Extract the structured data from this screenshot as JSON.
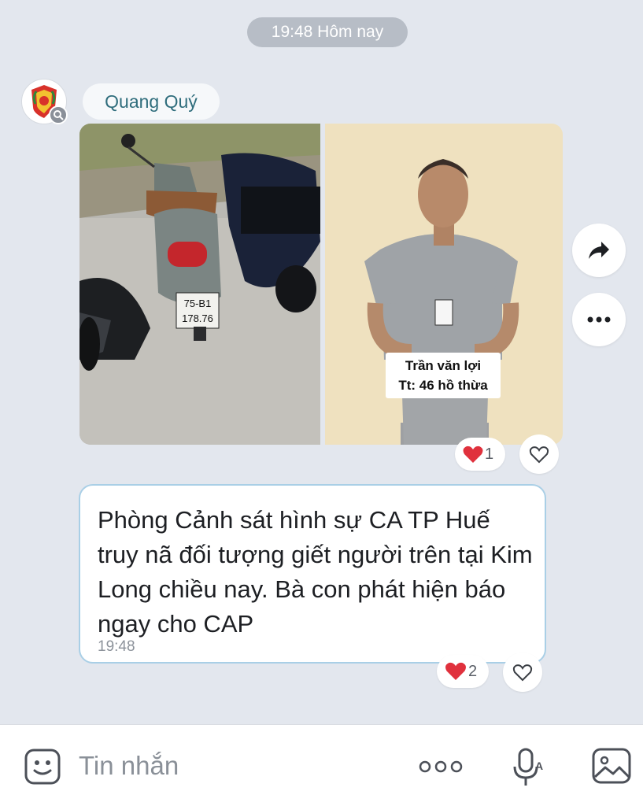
{
  "date_separator": "19:48 Hôm nay",
  "sender": {
    "name": "Quang Quý",
    "avatar_icon": "police-emblem-icon"
  },
  "photos": {
    "photo_1": {
      "description_icon": "motorbike-photo",
      "plate_line1": "75-B1",
      "plate_line2": "178.76"
    },
    "photo_2": {
      "caption_line1": "Trần văn lợi",
      "caption_line2": "Tt: 46 hồ thừa"
    }
  },
  "photo_reactions": {
    "heart_icon": "heart-icon",
    "count": "1"
  },
  "message": {
    "text": "Phòng Cảnh sát hình sự CA TP Huế truy nã đối tượng giết người trên tại Kim Long chiều nay. Bà con phát hiện báo ngay cho CAP",
    "time": "19:48"
  },
  "message_reactions": {
    "heart_icon": "heart-icon",
    "count": "2"
  },
  "side_actions": [
    "share-icon",
    "more-icon"
  ],
  "composer": {
    "placeholder": "Tin nhắn",
    "icons": [
      "emoji-icon",
      "more-options-icon",
      "voice-to-text-icon",
      "image-icon"
    ]
  },
  "colors": {
    "background": "#e3e7ee",
    "sender_name": "#2f6d7c",
    "bubble_border": "#a9cfe6",
    "heart": "#e0313d"
  }
}
